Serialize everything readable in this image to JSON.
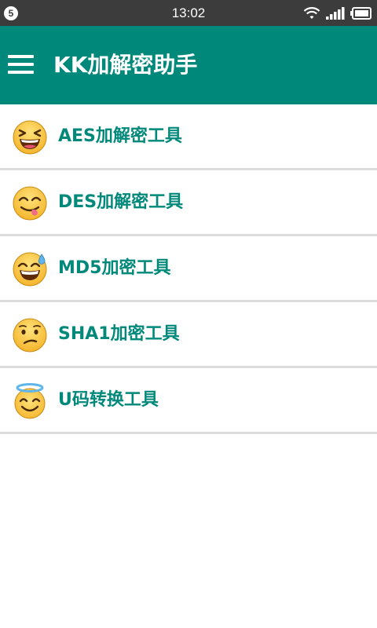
{
  "status_bar": {
    "badge": "5",
    "time": "13:02",
    "icons": [
      "wifi-icon",
      "signal-icon",
      "battery-icon"
    ]
  },
  "app_bar": {
    "menu_icon": "hamburger-menu-icon",
    "title": "KK加解密助手",
    "color": "#00897b"
  },
  "tools": [
    {
      "label": "AES加解密工具",
      "icon": "laughing-emoji-icon"
    },
    {
      "label": "DES加解密工具",
      "icon": "savoring-emoji-icon"
    },
    {
      "label": "MD5加密工具",
      "icon": "sweat-smile-emoji-icon"
    },
    {
      "label": "SHA1加密工具",
      "icon": "confused-emoji-icon"
    },
    {
      "label": "U码转换工具",
      "icon": "halo-emoji-icon"
    }
  ],
  "colors": {
    "accent": "#00897b",
    "status_bar": "#3c3c3c",
    "divider": "#dddddd"
  }
}
